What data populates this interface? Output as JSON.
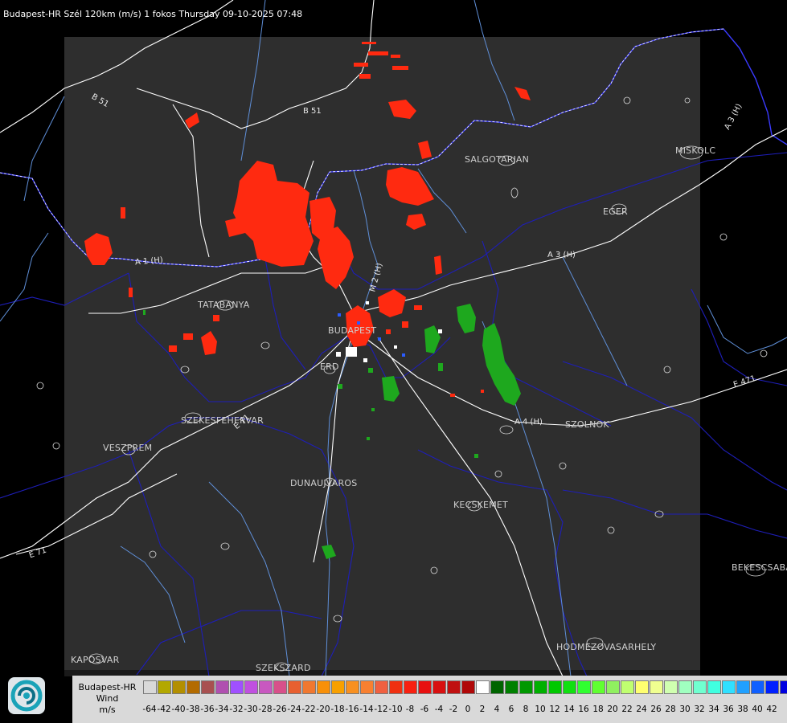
{
  "title": "Budapest-HR Szél 120km (m/s) 1 fokos Thursday 09-10-2025 07:48",
  "colors": {
    "background": "#000000",
    "radar_area": "#2e2e2e",
    "border": "#1f1fcc",
    "rivers": "#5f8fd8",
    "roads": "#ffffff",
    "receding": "#ff2a10",
    "approaching": "#1ea81e"
  },
  "cities": [
    {
      "name": "SALGOTARJAN"
    },
    {
      "name": "MISKOLC"
    },
    {
      "name": "EGER"
    },
    {
      "name": "TATABANYA"
    },
    {
      "name": "BUDAPEST"
    },
    {
      "name": "ERD"
    },
    {
      "name": "SZEKESFEHERVAR"
    },
    {
      "name": "VESZPREM"
    },
    {
      "name": "DUNAUJVAROS"
    },
    {
      "name": "KECSKEMET"
    },
    {
      "name": "SZOLNOK"
    },
    {
      "name": "BEKESCSABA"
    },
    {
      "name": "HODMEZOVASARHELY"
    },
    {
      "name": "KAPOSVAR"
    },
    {
      "name": "SZEKSZARD"
    }
  ],
  "roads": [
    {
      "name": "B 51"
    },
    {
      "name": "B 51"
    },
    {
      "name": "A 3 (H)"
    },
    {
      "name": "A 3 (H)"
    },
    {
      "name": "A 1 (H)"
    },
    {
      "name": "A 4 (H)"
    },
    {
      "name": "E 71"
    },
    {
      "name": "E 71"
    },
    {
      "name": "E 471"
    },
    {
      "name": "M 2 (H)"
    }
  ],
  "legend": {
    "station": "Budapest-HR",
    "quantity": "Wind",
    "unit": "m/s",
    "ticks": [
      "-64",
      "-42",
      "-40",
      "-38",
      "-36",
      "-34",
      "-32",
      "-30",
      "-28",
      "-26",
      "-24",
      "-22",
      "-20",
      "-18",
      "-16",
      "-14",
      "-12",
      "-10",
      "-8",
      "-6",
      "-4",
      "-2",
      "0",
      "2",
      "4",
      "6",
      "8",
      "10",
      "12",
      "14",
      "16",
      "18",
      "20",
      "22",
      "24",
      "26",
      "28",
      "30",
      "32",
      "34",
      "36",
      "38",
      "40",
      "42"
    ],
    "swatch_colors": [
      "#d9d9d9",
      "#b3a800",
      "#b38f00",
      "#b36b00",
      "#a85050",
      "#b050b0",
      "#a050ff",
      "#c050e0",
      "#c858c0",
      "#d8508a",
      "#e86030",
      "#f07830",
      "#f89008",
      "#f8a000",
      "#f89020",
      "#f88030",
      "#f06040",
      "#f03010",
      "#f82010",
      "#e81010",
      "#d81010",
      "#c01010",
      "#b00808",
      "#ffffff",
      "#006400",
      "#008000",
      "#009800",
      "#00b000",
      "#00c800",
      "#10e010",
      "#30ff30",
      "#60ff30",
      "#90f060",
      "#c0ff70",
      "#ffff70",
      "#f0ff90",
      "#d0ffb0",
      "#a0ffc0",
      "#70ffd0",
      "#40ffe0",
      "#30e0ff",
      "#20a0ff",
      "#1060ff",
      "#0020ff",
      "#0000e0"
    ]
  }
}
